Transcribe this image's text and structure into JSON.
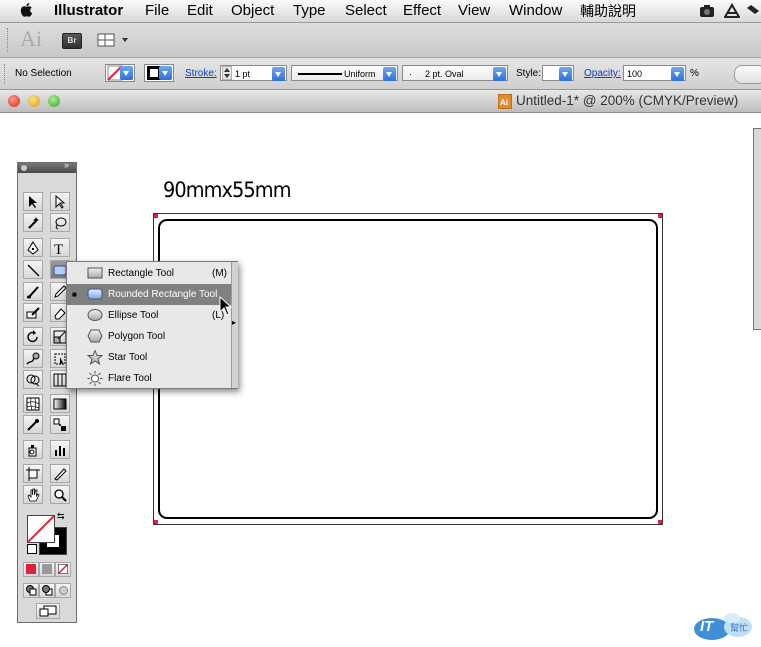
{
  "menubar": {
    "app_name": "Illustrator",
    "items": [
      "File",
      "Edit",
      "Object",
      "Type",
      "Select",
      "Effect",
      "View",
      "Window",
      "輔助說明"
    ]
  },
  "appbar": {
    "logo": "Ai",
    "bridge": "Br"
  },
  "controlbar": {
    "selection": "No Selection",
    "stroke_label": "Stroke:",
    "stroke_weight": "1 pt",
    "profile": "Uniform",
    "brush_dash": "·",
    "brush": "2 pt. Oval",
    "style_label": "Style:",
    "opacity_label": "Opacity:",
    "opacity_value": "100",
    "percent": "%"
  },
  "document": {
    "title": "Untitled-1* @ 200% (CMYK/Preview)",
    "artboard_note": "90mmx55mm"
  },
  "flyout": {
    "items": [
      {
        "label": "Rectangle Tool",
        "shortcut": "(M)",
        "icon": "rectangle-icon"
      },
      {
        "label": "Rounded Rectangle Tool",
        "shortcut": "",
        "icon": "rounded-rectangle-icon"
      },
      {
        "label": "Ellipse Tool",
        "shortcut": "(L)",
        "icon": "ellipse-icon"
      },
      {
        "label": "Polygon Tool",
        "shortcut": "",
        "icon": "polygon-icon"
      },
      {
        "label": "Star Tool",
        "shortcut": "",
        "icon": "star-icon"
      },
      {
        "label": "Flare Tool",
        "shortcut": "",
        "icon": "flare-icon"
      }
    ],
    "highlighted": "Rounded Rectangle Tool"
  },
  "watermark": {
    "text": "IT",
    "subtext": "幫忙"
  },
  "colors": {
    "highlight": "#808080",
    "link": "#1040c0",
    "artboard_border": "#000000",
    "bleed_mark": "#e0203c"
  }
}
